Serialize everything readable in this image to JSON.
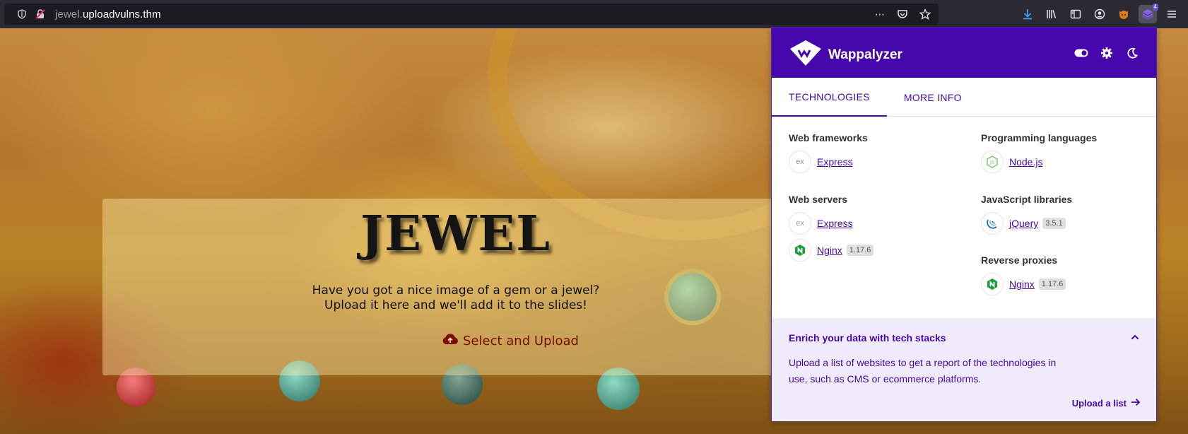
{
  "browser": {
    "url_subdomain": "jewel.",
    "url_domain": "uploadvulns.thm",
    "more_icon": "⋯",
    "extension_badge": "4"
  },
  "page": {
    "title": "JEWEL",
    "line1": "Have you got a nice image of a gem or a jewel?",
    "line2": "Upload it here and we'll add it to the slides!",
    "upload_label": "Select and Upload"
  },
  "wappalyzer": {
    "brand": "Wappalyzer",
    "tabs": [
      {
        "label": "TECHNOLOGIES"
      },
      {
        "label": "MORE INFO"
      }
    ],
    "categories": [
      {
        "title": "Web frameworks",
        "techs": [
          {
            "name": "Express",
            "icon": "ex"
          }
        ]
      },
      {
        "title": "Web servers",
        "techs": [
          {
            "name": "Express",
            "icon": "ex"
          },
          {
            "name": "Nginx",
            "version": "1.17.6"
          }
        ]
      },
      {
        "title": "Programming languages",
        "techs": [
          {
            "name": "Node.js",
            "icon": "JS"
          }
        ]
      },
      {
        "title": "JavaScript libraries",
        "techs": [
          {
            "name": "jQuery",
            "version": "3.5.1"
          }
        ]
      },
      {
        "title": "Reverse proxies",
        "techs": [
          {
            "name": "Nginx",
            "version": "1.17.6"
          }
        ]
      }
    ],
    "footer": {
      "title": "Enrich your data with tech stacks",
      "text": "Upload a list of websites to get a report of the technologies in use, such as CMS or ecommerce platforms.",
      "link": "Upload a list"
    }
  },
  "colors": {
    "wappalyzer_purple": "#4608ad",
    "upload_red": "#7a0c06"
  }
}
